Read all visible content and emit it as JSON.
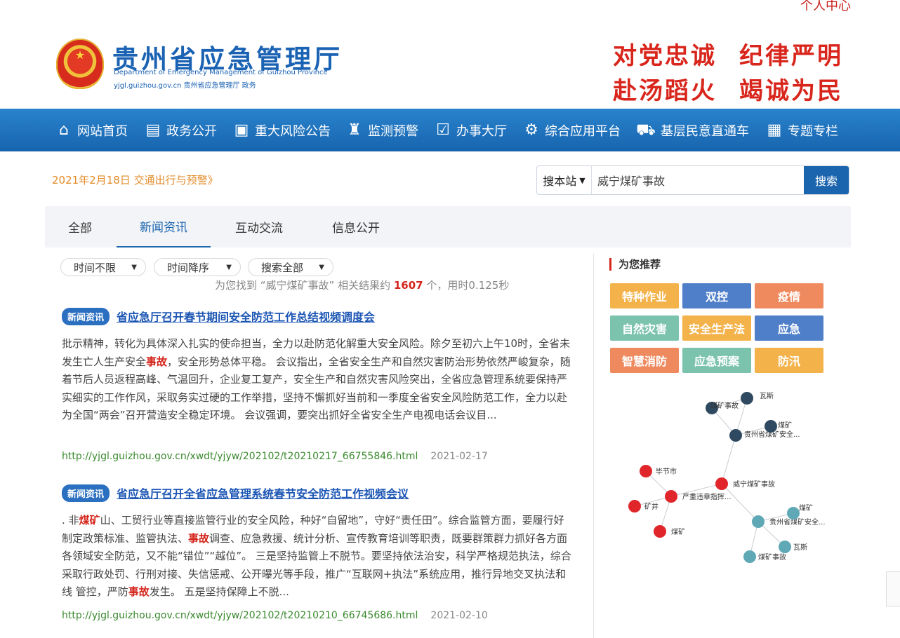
{
  "header": {
    "user_center": "个人中心",
    "title": "贵州省应急管理厅",
    "subtitle_en": "Department of Emergency Management of Guizhou Province",
    "site_url": "yjgl.guizhou.gov.cn  贵州省应急管理厅 政务",
    "slogans": [
      "对党忠诚",
      "纪律严明",
      "赴汤蹈火",
      "竭诚为民"
    ]
  },
  "nav": {
    "items": [
      {
        "label": "网站首页",
        "icon": "home-icon"
      },
      {
        "label": "政务公开",
        "icon": "document-icon"
      },
      {
        "label": "重大风险公告",
        "icon": "alert-board-icon"
      },
      {
        "label": "监测预警",
        "icon": "monitor-tower-icon"
      },
      {
        "label": "办事大厅",
        "icon": "checkbox-icon"
      },
      {
        "label": "综合应用平台",
        "icon": "gear-icon"
      },
      {
        "label": "基层民意直通车",
        "icon": "car-icon"
      },
      {
        "label": "专题专栏",
        "icon": "calculator-icon"
      }
    ]
  },
  "date_line": "2021年2月18日 交通出行与预警》",
  "search": {
    "scope": "搜本站",
    "value": "威宁煤矿事故",
    "button": "搜索"
  },
  "tabs": [
    "全部",
    "新闻资讯",
    "互动交流",
    "信息公开"
  ],
  "active_tab": "新闻资讯",
  "filters": [
    "时间不限",
    "时间降序",
    "搜索全部"
  ],
  "result_summary": {
    "prefix": "为您找到 “威宁煤矿事故” 相关结果约",
    "count": "1607",
    "suffix": "个，用时0.125秒"
  },
  "results": [
    {
      "badge": "新闻资讯",
      "title": "省应急厅召开春节期间安全防范工作总结视频调度会",
      "body_parts": [
        {
          "t": "批示精神，转化为具体深入扎实的使命担当，全力以赴防范化解重大安全风险。除夕至初六上午10时，全省未发生亡人生产安全"
        },
        {
          "t": "事故",
          "hl": true
        },
        {
          "t": "，安全形势总体平稳。 会议指出，全省安全生产和自然灾害防治形势依然严峻复杂，随着节后人员返程高峰、气温回升，企业复工复产，安全生产和自然灾害风险突出，全省应急管理系统要保持严实细实的工作作风，采取务实过硬的工作举措，坚持不懈抓好当前和一季度全省安全风险防范工作，全力以赴为全国“两会”召开营造安全稳定环境。 会议强调，要突出抓好全省安全生产电视电话会议目..."
        }
      ],
      "url": "http://yjgl.guizhou.gov.cn/xwdt/yjyw/202102/t20210217_66755846.html",
      "date": "2021-02-17"
    },
    {
      "badge": "新闻资讯",
      "title": "省应急厅召开全省应急管理系统春节安全防范工作视频会议",
      "body_parts": [
        {
          "t": ". 非"
        },
        {
          "t": "煤矿",
          "hl": true
        },
        {
          "t": "山、工贸行业等直接监管行业的安全风险，种好“自留地”，守好“责任田”。综合监管方面，要履行好制定政策标准、监管执法、"
        },
        {
          "t": "事故",
          "hl": true
        },
        {
          "t": "调查、应急救援、统计分析、宣传教育培训等职责，既要群策群力抓好各方面各领域安全防范，又不能“错位”“越位”。 三是坚持监管上不脱节。要坚持依法治安，科学严格规范执法，综合采取行政处罚、行刑对接、失信惩戒、公开曝光等手段，推广“互联网+执法”系统应用，推行异地交叉执法和线 管控，严防"
        },
        {
          "t": "事故",
          "hl": true
        },
        {
          "t": "发生。 五是坚持保障上不脱..."
        }
      ],
      "url": "http://yjgl.guizhou.gov.cn/xwdt/yjyw/202102/t20210210_66745686.html",
      "date": "2021-02-10"
    }
  ],
  "recommend": {
    "title": "为您推荐",
    "tags": [
      {
        "label": "特种作业",
        "color": "#f4b24a"
      },
      {
        "label": "双控",
        "color": "#4f7fc9"
      },
      {
        "label": "疫情",
        "color": "#ef8a5f"
      },
      {
        "label": "自然灾害",
        "color": "#7cc3ad"
      },
      {
        "label": "安全生产法",
        "color": "#f4b24a"
      },
      {
        "label": "应急",
        "color": "#4f7fc9"
      },
      {
        "label": "智慧消防",
        "color": "#ef8a5f"
      },
      {
        "label": "应急预案",
        "color": "#7cc3ad"
      },
      {
        "label": "防汛",
        "color": "#f4b24a"
      }
    ]
  },
  "graph": {
    "nodes": [
      {
        "label": "煤矿事故",
        "group": "dark"
      },
      {
        "label": "瓦斯",
        "group": "dark"
      },
      {
        "label": "贵州省煤矿安全...",
        "group": "dark"
      },
      {
        "label": "煤矿",
        "group": "dark"
      },
      {
        "label": "毕节市",
        "group": "red"
      },
      {
        "label": "威宁煤矿事故",
        "group": "red"
      },
      {
        "label": "严重违章指挥...",
        "group": "red"
      },
      {
        "label": "矿井",
        "group": "red"
      },
      {
        "label": "煤矿",
        "group": "red"
      },
      {
        "label": "贵州省煤矿安全...",
        "group": "teal"
      },
      {
        "label": "煤矿",
        "group": "teal"
      },
      {
        "label": "瓦斯",
        "group": "teal"
      },
      {
        "label": "煤矿事故",
        "group": "teal"
      }
    ],
    "colors": {
      "dark": "#2f4a60",
      "red": "#e0262b",
      "teal": "#5fa8b5"
    }
  }
}
